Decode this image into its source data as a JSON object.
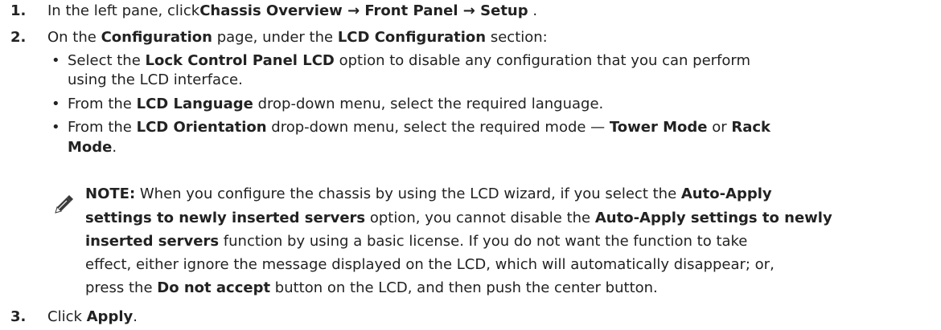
{
  "steps": [
    {
      "number": "1.",
      "text_a": "In the left pane, click",
      "bold_path": "Chassis Overview → Front Panel → Setup",
      "text_b": " ."
    },
    {
      "number": "2.",
      "text_a": "On the ",
      "bold_a": "Configuration",
      "text_b": " page, under the ",
      "bold_b": "LCD Configuration",
      "text_c": " section:"
    },
    {
      "number": "3.",
      "text_a": "Click ",
      "bold_a": "Apply",
      "text_b": "."
    }
  ],
  "bullets": [
    {
      "a": "Select the ",
      "b": "Lock Control Panel LCD",
      "c": " option to disable any configuration that you can perform",
      "d": "using the LCD interface."
    },
    {
      "a": "From the ",
      "b": "LCD Language",
      "c": " drop-down menu, select the required language."
    },
    {
      "a": "From the ",
      "b": "LCD Orientation",
      "c": " drop-down menu, select the required mode — ",
      "d": "Tower Mode",
      "e": " or ",
      "f": "Rack",
      "g": "Mode",
      "h": "."
    }
  ],
  "bullet_symbol": "•",
  "note": {
    "icon": "pencil-note-icon",
    "label": "NOTE:",
    "l1_a": " When you configure the chassis by using the LCD wizard, if you select the ",
    "l1_b": "Auto-Apply",
    "l2_a": "settings to newly inserted servers",
    "l2_b": " option, you cannot disable the ",
    "l2_c": "Auto-Apply settings to newly",
    "l3_a": "inserted servers",
    "l3_b": " function by using a basic license. If you do not want the function to take",
    "l4": "effect, either ignore the message displayed on the LCD, which will automatically disappear; or,",
    "l5_a": "press the ",
    "l5_b": "Do not accept",
    "l5_c": " button on the LCD, and then push the center button."
  }
}
